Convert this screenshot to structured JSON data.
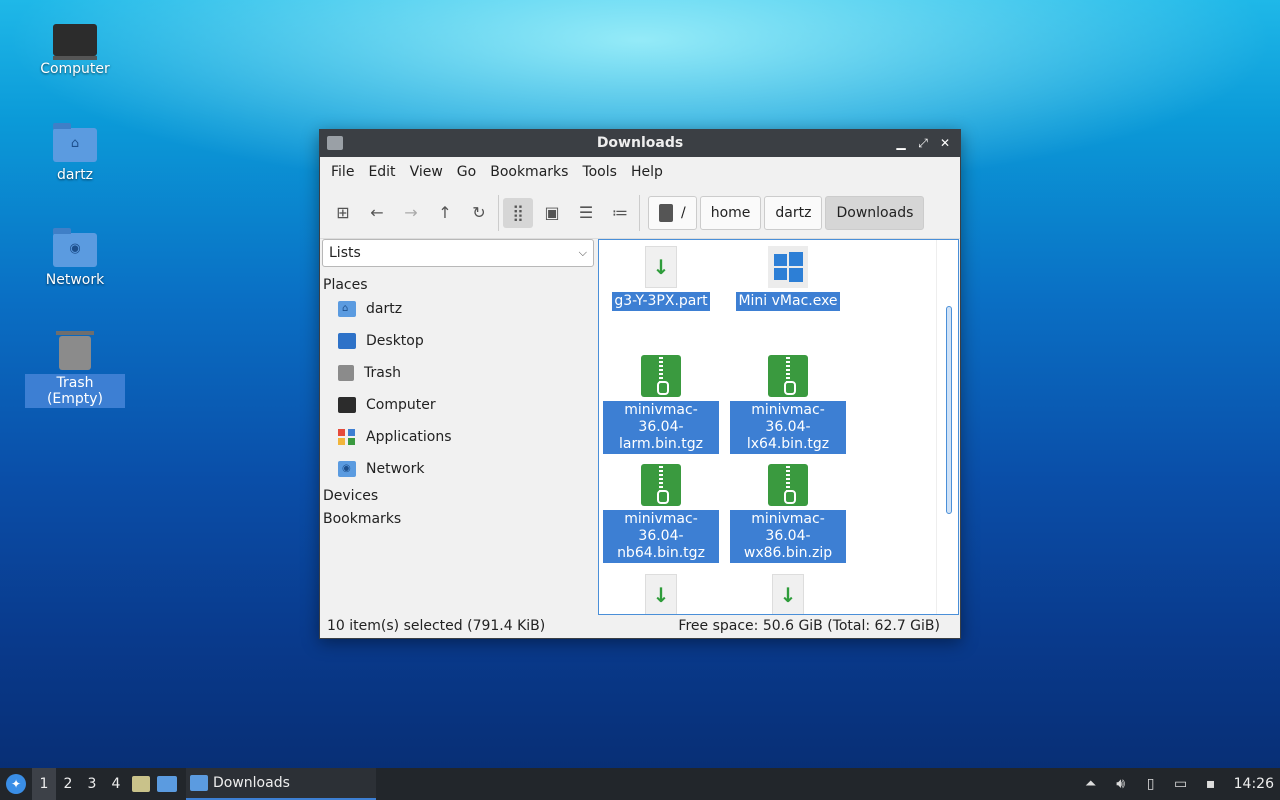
{
  "desktop": {
    "icons": [
      {
        "label": "Computer",
        "icon": "computer-icon"
      },
      {
        "label": "dartz",
        "icon": "home-folder-icon"
      },
      {
        "label": "Network",
        "icon": "network-folder-icon"
      },
      {
        "label": "Trash (Empty)",
        "icon": "trash-icon"
      }
    ]
  },
  "window": {
    "title": "Downloads",
    "menu": [
      "File",
      "Edit",
      "View",
      "Go",
      "Bookmarks",
      "Tools",
      "Help"
    ],
    "path": {
      "root": "/",
      "segments": [
        "home",
        "dartz",
        "Downloads"
      ]
    },
    "sidebar": {
      "mode": "Lists",
      "places_header": "Places",
      "places": [
        {
          "label": "dartz",
          "icon": "home-folder-icon"
        },
        {
          "label": "Desktop",
          "icon": "desktop-icon"
        },
        {
          "label": "Trash",
          "icon": "trash-icon"
        },
        {
          "label": "Computer",
          "icon": "computer-icon"
        },
        {
          "label": "Applications",
          "icon": "applications-icon"
        },
        {
          "label": "Network",
          "icon": "network-icon"
        }
      ],
      "devices_header": "Devices",
      "bookmarks_header": "Bookmarks"
    },
    "files": [
      {
        "name": "g3-Y-3PX.part",
        "lines": [
          "g3-Y-3PX.part"
        ],
        "type": "part"
      },
      {
        "name": "Mini vMac.exe",
        "lines": [
          "Mini vMac.exe"
        ],
        "type": "exe"
      },
      {
        "name": "minivmac-36.04-larm.bin.tgz",
        "lines": [
          "minivmac-36.04-",
          "larm.bin.tgz"
        ],
        "type": "zip"
      },
      {
        "name": "minivmac-36.04-lx64.bin.tgz",
        "lines": [
          "minivmac-36.04-",
          "lx64.bin.tgz"
        ],
        "type": "zip"
      },
      {
        "name": "minivmac-36.04-nb64.bin.tgz",
        "lines": [
          "minivmac-36.04-",
          "nb64.bin.tgz"
        ],
        "type": "zip"
      },
      {
        "name": "minivmac-36.04-wx86.bin.zip",
        "lines": [
          "minivmac-36.04-",
          "wx86.bin.zip"
        ],
        "type": "zip"
      },
      {
        "name": "",
        "lines": [],
        "type": "part"
      },
      {
        "name": "",
        "lines": [],
        "type": "part"
      }
    ],
    "status": {
      "selection": "10 item(s) selected (791.4 KiB)",
      "free_space": "Free space: 50.6 GiB (Total: 62.7 GiB)"
    }
  },
  "taskbar": {
    "workspaces": [
      "1",
      "2",
      "3",
      "4"
    ],
    "active_workspace": "1",
    "task_label": "Downloads",
    "clock": "14:26"
  },
  "colors": {
    "selection": "#3d7fd3",
    "titlebar": "#3b3f44",
    "taskbar": "#22262b",
    "folder": "#5b9be0",
    "archive": "#3a9a3f"
  }
}
